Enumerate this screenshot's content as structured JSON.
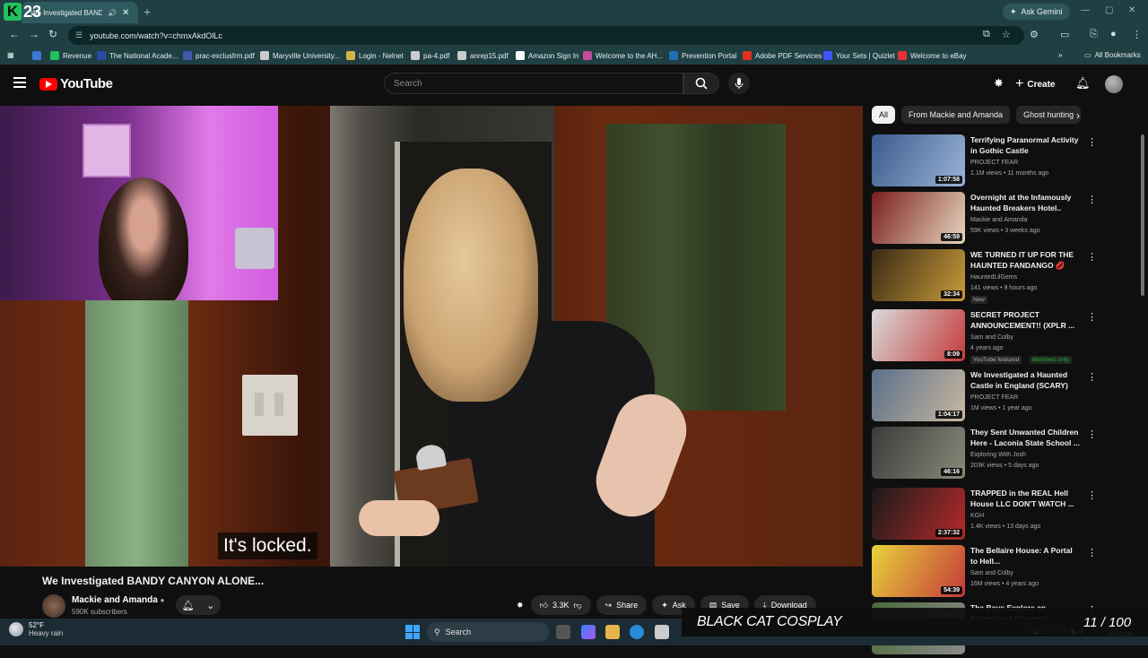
{
  "browser": {
    "tab_title": "We Investigated BANDY CANYON ALONE...",
    "ask_gemini": "Ask Gemini",
    "url": "youtube.com/watch?v=chmxAkdOlLc",
    "badge_letter": "K",
    "badge_number": "23"
  },
  "bookmarks": [
    {
      "label": "Revenue",
      "color": "#21c25e"
    },
    {
      "label": "The National Acade...",
      "color": "#2b4aa8"
    },
    {
      "label": "prac-exclusfrm.pdf",
      "color": "#3f5bb0"
    },
    {
      "label": "Maryville University...",
      "color": "#cccccc"
    },
    {
      "label": "Login - Nelnet",
      "color": "#d6b34a"
    },
    {
      "label": "pa-4.pdf",
      "color": "#cccccc"
    },
    {
      "label": "anrep15.pdf",
      "color": "#cccccc"
    },
    {
      "label": "Amazon Sign In",
      "color": "#ffffff"
    },
    {
      "label": "Welcome to the AH...",
      "color": "#c84a9a"
    },
    {
      "label": "Prevention Portal",
      "color": "#1e6fb8"
    },
    {
      "label": "Adobe PDF Services",
      "color": "#e0311e"
    },
    {
      "label": "Your Sets | Quizlet",
      "color": "#4255ff"
    },
    {
      "label": "Welcome to eBay",
      "color": "#e53238"
    }
  ],
  "all_bookmarks": "All Bookmarks",
  "youtube": {
    "logo_text": "YouTube",
    "search_placeholder": "Search",
    "create_label": "Create"
  },
  "video": {
    "caption": "It's locked.",
    "title": "We Investigated BANDY CANYON ALONE...",
    "channel": "Mackie and Amanda",
    "subscribers": "590K subscribers",
    "likes": "3.3K",
    "share": "Share",
    "ask": "Ask",
    "save": "Save",
    "download": "Download"
  },
  "chips": [
    "All",
    "From Mackie and Amanda",
    "Ghost hunting"
  ],
  "recommendations": [
    {
      "title": "Terrifying Paranormal Activity in Gothic Castle",
      "channel": "PROJECT FEAR",
      "meta": "1.1M views • 11 months ago",
      "duration": "1:07:58",
      "colors": [
        "#3b5b8c",
        "#9ab4d8"
      ]
    },
    {
      "title": "Overnight at the Infamously Haunted Breakers Hotel..",
      "channel": "Mackie and Amanda",
      "meta": "59K views • 3 weeks ago",
      "duration": "46:59",
      "colors": [
        "#7a1e1e",
        "#e7d7c0"
      ]
    },
    {
      "title": "WE TURNED IT UP FOR THE HAUNTED FANDANGO 💋",
      "channel": "HauntedLilGems",
      "meta": "141 views • 9 hours ago",
      "badge": "New",
      "duration": "32:34",
      "colors": [
        "#3a2a14",
        "#c89a3a"
      ]
    },
    {
      "title": "SECRET PROJECT ANNOUNCEMENT!! (XPLR ...",
      "channel": "Sam and Colby",
      "meta": "4 years ago",
      "badge": "YouTube featured",
      "members": "Members only",
      "duration": "8:09",
      "colors": [
        "#d9d9d9",
        "#c43b3b"
      ]
    },
    {
      "title": "We Investigated a Haunted Castle in England (SCARY)",
      "channel": "PROJECT FEAR",
      "meta": "1M views • 1 year ago",
      "duration": "1:04:17",
      "colors": [
        "#5a6f8a",
        "#c9b8a0"
      ]
    },
    {
      "title": "They Sent Unwanted Children Here - Laconia State School ...",
      "channel": "Exploring With Josh",
      "meta": "203K views • 5 days ago",
      "duration": "46:16",
      "colors": [
        "#3a3a3a",
        "#8a8a7a"
      ]
    },
    {
      "title": "TRAPPED in the REAL Hell House LLC DON'T WATCH ...",
      "channel": "KGH",
      "meta": "1.4K views • 13 days ago",
      "duration": "2:37:32",
      "colors": [
        "#1a1a1a",
        "#b52a2a"
      ]
    },
    {
      "title": "The Bellaire House: A Portal to Hell...",
      "channel": "Sam and Colby",
      "meta": "16M views • 4 years ago",
      "duration": "54:39",
      "colors": [
        "#e8d23a",
        "#c43a3a"
      ]
    },
    {
      "title": "The Boys Explore an Abandoned Minecraft",
      "channel": "",
      "meta": "",
      "duration": "",
      "colors": [
        "#4a6a3a",
        "#8a8a8a"
      ]
    }
  ],
  "taskbar": {
    "temp": "52°F",
    "weather": "Heavy rain",
    "search": "Search",
    "overlay_label": "BLACK CAT COSPLAY",
    "overlay_counter": "11 / 100",
    "date": "4/4/2026"
  }
}
